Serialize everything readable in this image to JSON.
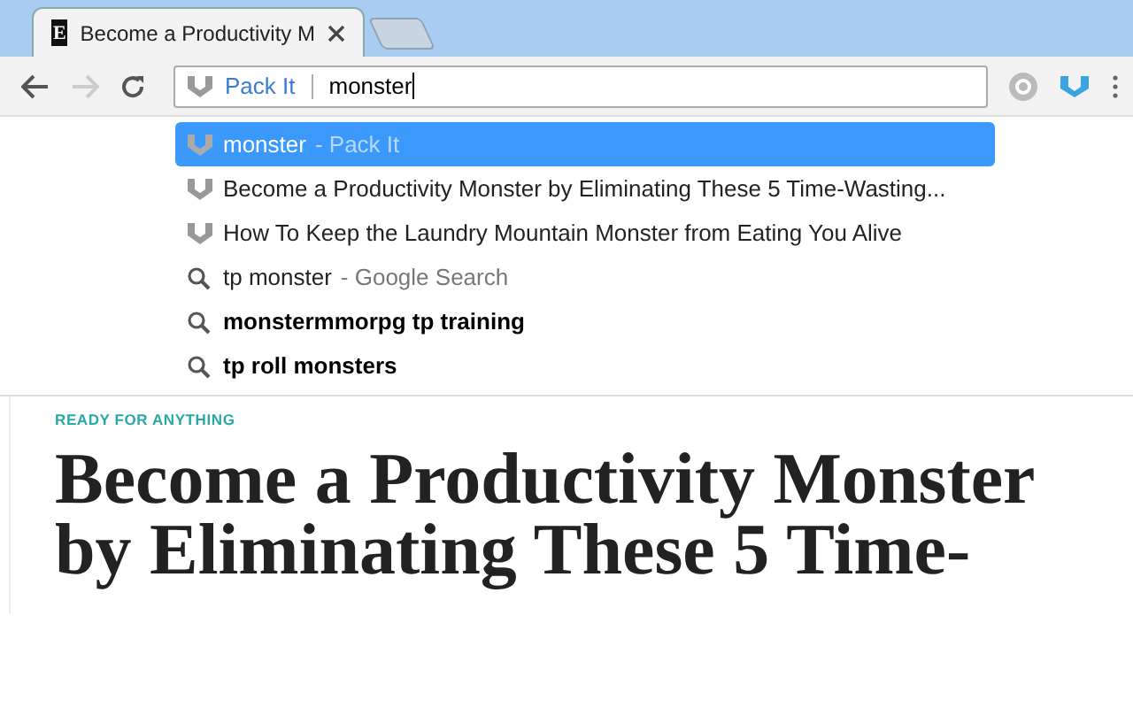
{
  "tabs": [
    {
      "title": "Become a Productivity M",
      "favicon": "E",
      "selected": true
    },
    {
      "selected": false
    }
  ],
  "omnibox": {
    "keyword": "Pack It",
    "value": "monster"
  },
  "suggestions": [
    {
      "kind": "extension",
      "text": "monster",
      "description": "- Pack It",
      "bold": false,
      "selected": true
    },
    {
      "kind": "extension",
      "text": "Become a Productivity Monster by Eliminating These 5 Time-Wasting...",
      "bold": false,
      "selected": false
    },
    {
      "kind": "extension",
      "text": "How To Keep the Laundry Mountain Monster from Eating You Alive",
      "bold": false,
      "selected": false
    },
    {
      "kind": "search",
      "text": "tp monster",
      "description": "- Google Search",
      "bold": false,
      "selected": false
    },
    {
      "kind": "search",
      "text": "monstermmorpg tp training",
      "bold": true,
      "selected": false
    },
    {
      "kind": "search",
      "text": "tp roll monsters",
      "bold": true,
      "selected": false
    }
  ],
  "article": {
    "category": "READY FOR ANYTHING",
    "headline": "Become a Productivity Monster by Eliminating These 5 Time-"
  }
}
